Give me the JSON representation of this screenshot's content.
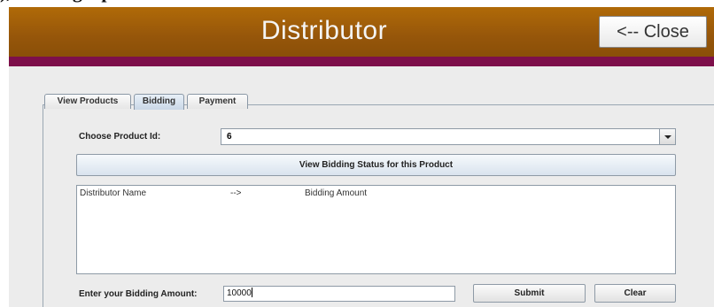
{
  "caption": "), Bidding Up",
  "window": {
    "title": "Distributor",
    "close_label": "<-- Close"
  },
  "tabs": [
    {
      "label": "View Products",
      "active": false
    },
    {
      "label": "Bidding",
      "active": true
    },
    {
      "label": "Payment",
      "active": false
    }
  ],
  "bidding": {
    "product_id_label": "Choose Product Id:",
    "product_id_value": "6",
    "view_status_button": "View Bidding Status for this Product",
    "status_columns": [
      "Distributor Name",
      "-->",
      "Bidding Amount"
    ],
    "amount_label": "Enter your Bidding Amount:",
    "amount_value": "10000",
    "submit_label": "Submit",
    "clear_label": "Clear"
  },
  "colors": {
    "header": "#96560a",
    "band": "#7d0f4a",
    "panel": "#ececec"
  }
}
